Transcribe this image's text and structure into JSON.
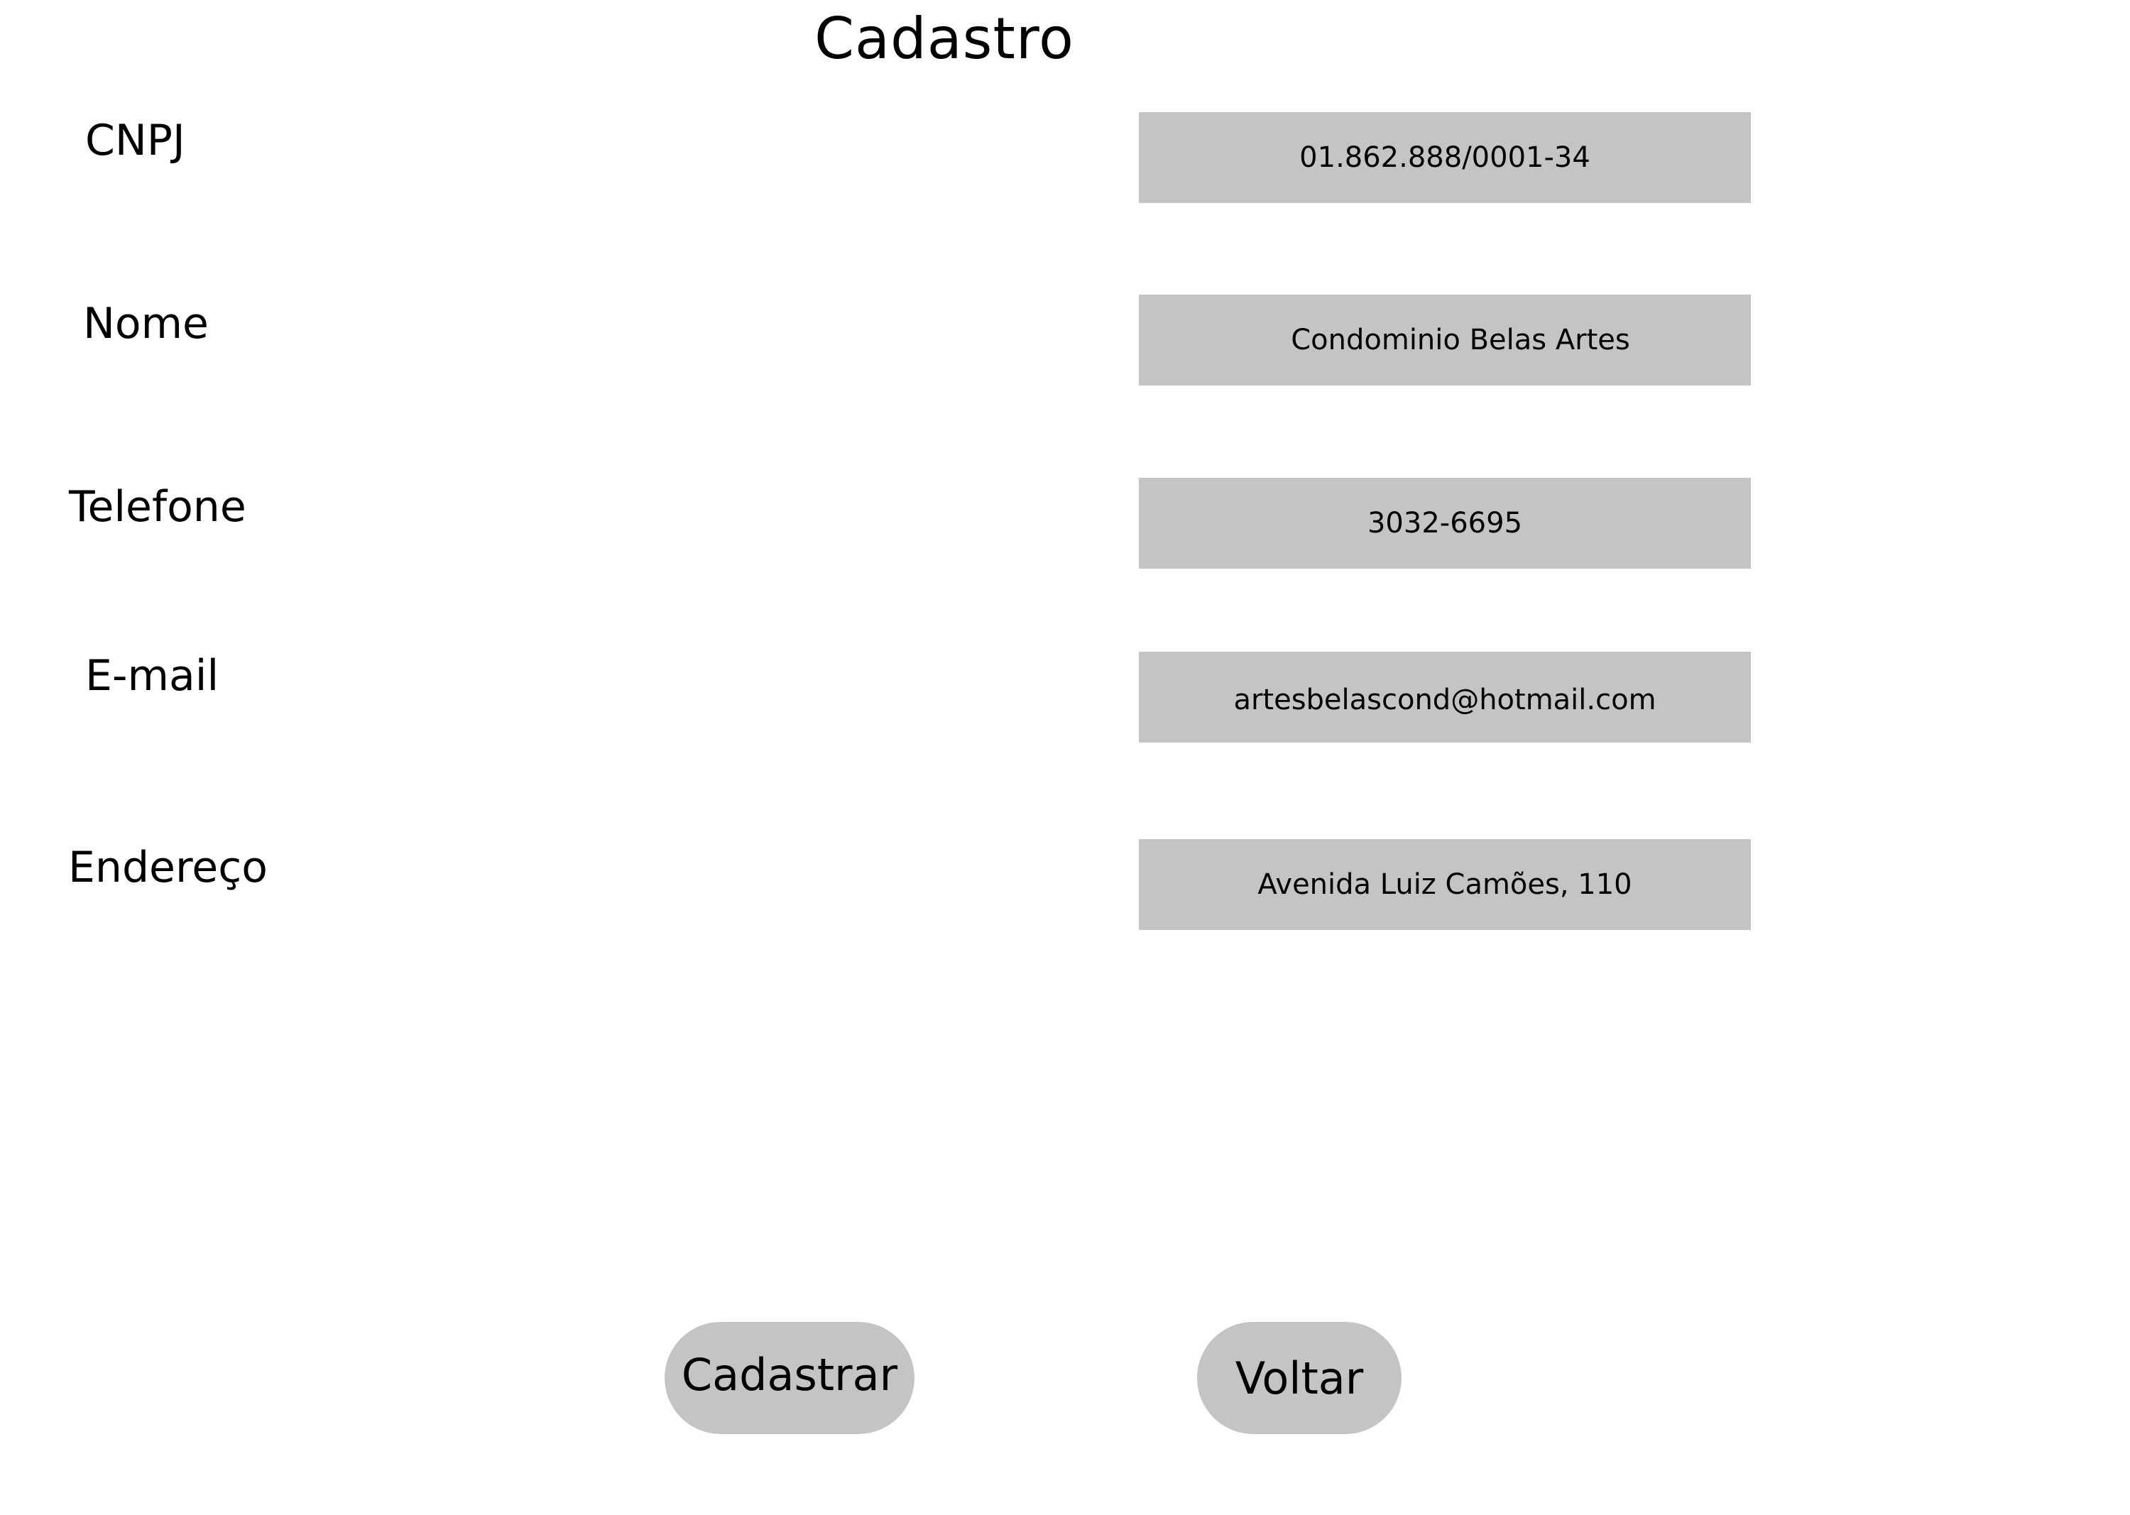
{
  "page": {
    "title": "Cadastro"
  },
  "form": {
    "fields": [
      {
        "label": "CNPJ",
        "value": "01.862.888/0001-34"
      },
      {
        "label": "Nome",
        "value": "Condominio Belas Artes"
      },
      {
        "label": "Telefone",
        "value": "3032-6695"
      },
      {
        "label": "E-mail",
        "value": "artesbelascond@hotmail.com"
      },
      {
        "label": "Endereço",
        "value": "Avenida Luiz Camões, 110"
      }
    ]
  },
  "actions": {
    "submit_label": "Cadastrar",
    "back_label": "Voltar"
  },
  "colors": {
    "background": "#ffffff",
    "field_fill": "#c4c4c4",
    "button_fill": "#c4c4c4",
    "text": "#000000"
  }
}
